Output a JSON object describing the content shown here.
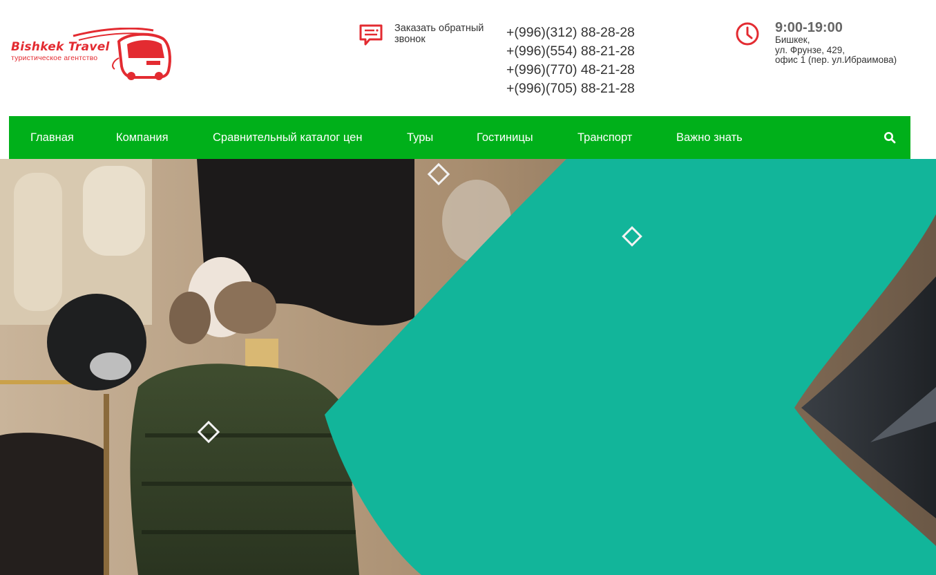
{
  "logo": {
    "name": "Bishkek Travel",
    "tagline": "туристическое агентство",
    "brand_color": "#e32b31"
  },
  "callback": {
    "icon": "chat-callback-icon",
    "label": "Заказать обратный звонок"
  },
  "phones": [
    "+(996)(312) 88-28-28",
    "+(996)(554) 88-21-28",
    "+(996)(770) 48-21-28",
    "+(996)(705) 88-21-28"
  ],
  "contact": {
    "icon": "clock-icon",
    "hours": "9:00-19:00",
    "address_lines": [
      "Бишкек,",
      "ул. Фрунзе, 429,",
      "офис 1 (пер. ул.Ибраимова)"
    ]
  },
  "nav": {
    "color": "#00b01a",
    "items": [
      "Главная",
      "Компания",
      "Сравнительный каталог цен",
      "Туры",
      "Гостиницы",
      "Транспорт",
      "Важно знать"
    ],
    "search_icon": "search-icon"
  },
  "hero": {
    "accent_color": "#12b59a"
  }
}
